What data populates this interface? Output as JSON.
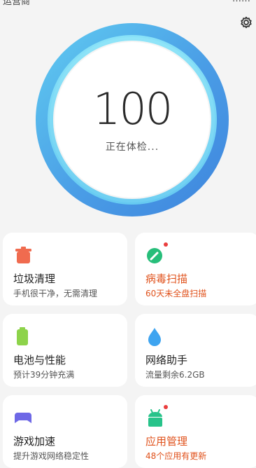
{
  "status_bar": {
    "left_text": "运营商",
    "right_text": "……"
  },
  "score": {
    "value": "100",
    "status": "正在体检..."
  },
  "colors": {
    "ring_outer": "#4a9de6",
    "ring_inner": "#7fdcf6",
    "alert": "#e0521c",
    "trash": "#f06b4f",
    "virus": "#27be7a",
    "battery": "#8dd34a",
    "network": "#3ea4f0",
    "game": "#6e68e6",
    "apps": "#27c38a"
  },
  "cards": [
    {
      "title": "垃圾清理",
      "subtitle": "手机很干净，无需清理",
      "icon": "trash-icon"
    },
    {
      "title": "病毒扫描",
      "subtitle": "60天未全盘扫描",
      "icon": "virus-scan-icon"
    },
    {
      "title": "电池与性能",
      "subtitle": "预计39分钟充满",
      "icon": "battery-icon"
    },
    {
      "title": "网络助手",
      "subtitle": "流量剩余6.2GB",
      "icon": "water-drop-icon"
    },
    {
      "title": "游戏加速",
      "subtitle": "提升游戏网络稳定性",
      "icon": "gamepad-icon"
    },
    {
      "title": "应用管理",
      "subtitle": "48个应用有更新",
      "icon": "android-icon"
    }
  ]
}
